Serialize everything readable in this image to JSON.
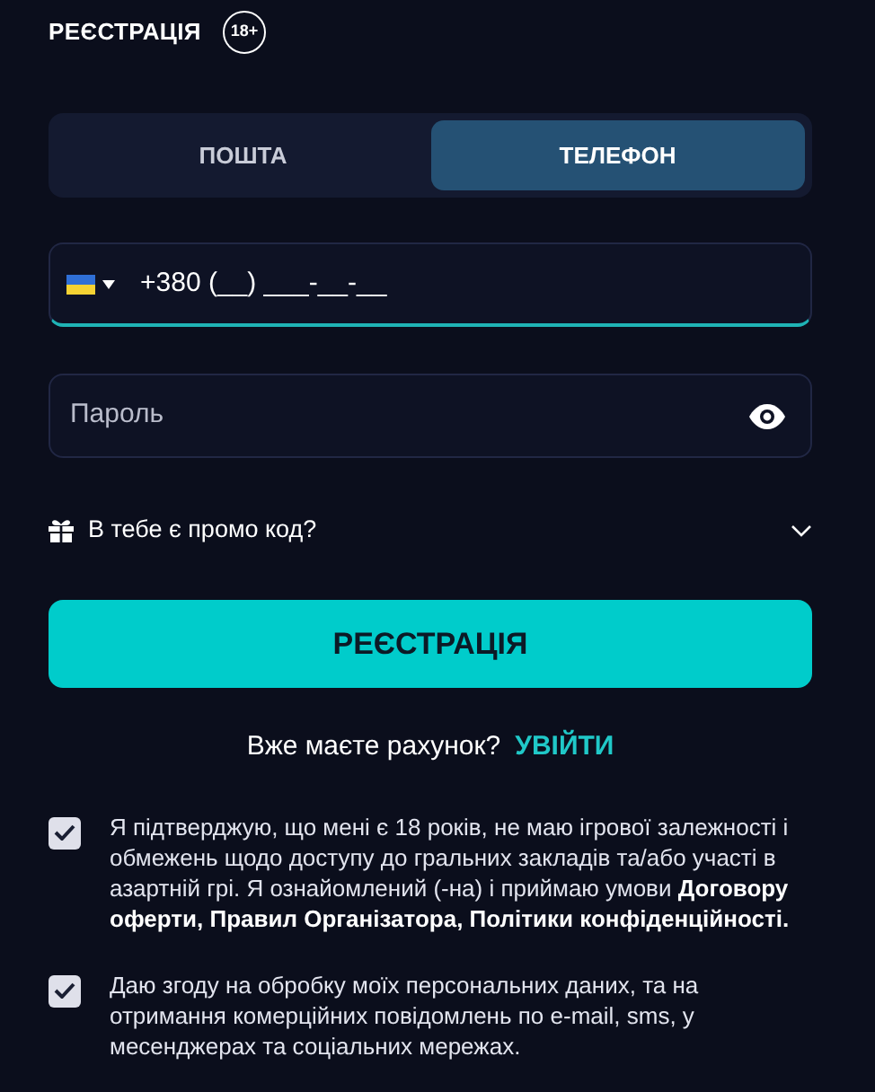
{
  "header": {
    "title": "РЕЄСТРАЦІЯ",
    "age_badge": "18+"
  },
  "tabs": [
    {
      "label": "ПОШТА",
      "selected": false
    },
    {
      "label": "ТЕЛЕФОН",
      "selected": true
    }
  ],
  "phone_field": {
    "value": "+380 (__) ___-__-__",
    "focused": true
  },
  "password_field": {
    "placeholder": "Пароль"
  },
  "promo": {
    "label": "В тебе є промо код?",
    "expanded": false
  },
  "submit_button": "РЕЄСТРАЦІЯ",
  "login_prompt": {
    "text": "Вже маєте рахунок?",
    "link": "УВІЙТИ"
  },
  "consents": [
    {
      "text": "Я підтверджую, що мені є 18 років, не маю ігрової залежності і обмежень щодо доступу до гральних закладів та/або участі в азартній грі. Я ознайомлений (-на) і приймаю умови **Договору оферти, Правил Організатора, Політики конфіденційності.**",
      "checked": true
    },
    {
      "text": "Даю згоду на обробку моїх персональних даних, та на отримання комерційних повідомлень по e-mail, sms, у месенджерах та соціальних мережах.",
      "checked": true
    }
  ]
}
